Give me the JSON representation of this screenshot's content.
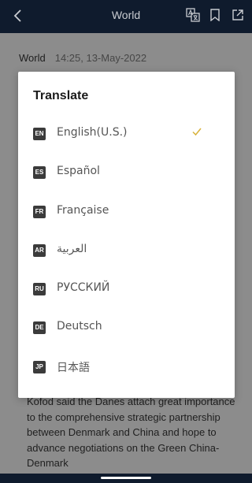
{
  "header": {
    "title": "World",
    "icons": [
      "back-arrow-icon",
      "translate-icon",
      "bookmark-icon",
      "share-icon"
    ]
  },
  "article": {
    "category": "World",
    "datetime": "14:25, 13-May-2022",
    "body": "Kofod said the Danes attach great importance to the comprehensive strategic partnership between Denmark and China and hope to advance negotiations on the Green China-Denmark"
  },
  "dialog": {
    "title": "Translate",
    "selected_language": "English(U.S.)",
    "languages": [
      {
        "code": "EN",
        "label": "English(U.S.)"
      },
      {
        "code": "ES",
        "label": "Español"
      },
      {
        "code": "FR",
        "label": "Française"
      },
      {
        "code": "AR",
        "label": "العربية"
      },
      {
        "code": "RU",
        "label": "РУССКИЙ"
      },
      {
        "code": "DE",
        "label": "Deutsch"
      },
      {
        "code": "JP",
        "label": "日本語"
      }
    ]
  },
  "colors": {
    "header_bg": "#0f1b2d",
    "check_color": "#d8b23a",
    "badge_bg": "#3b3b3b"
  }
}
